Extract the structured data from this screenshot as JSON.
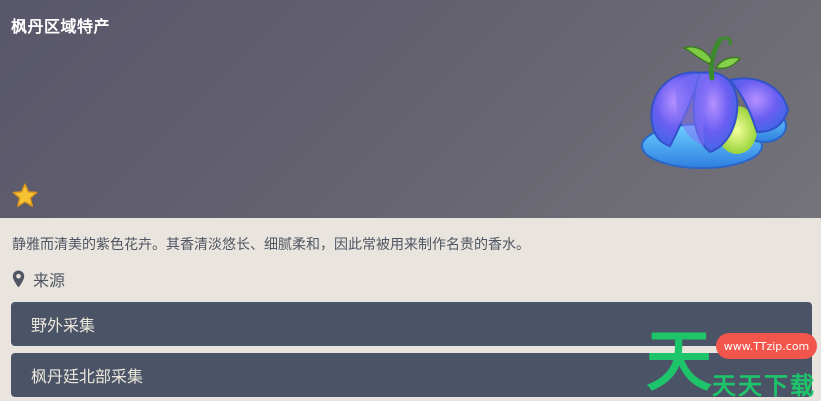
{
  "header": {
    "category": "枫丹区域特产",
    "rarity_stars": 1,
    "star_icon": "star-icon",
    "item_image": "violet-flower-bulb-image"
  },
  "description": "静雅而清美的紫色花卉。其香清淡悠长、细腻柔和，因此常被用来制作名贵的香水。",
  "source": {
    "icon": "location-pin-icon",
    "title": "来源",
    "items": [
      {
        "label": "野外采集"
      },
      {
        "label": "枫丹廷北部采集"
      }
    ]
  },
  "watermark": {
    "logo_glyph": "天",
    "url": "www.TTzip.com",
    "text": "天天下载"
  },
  "colors": {
    "header_bg": "#5f5d6b",
    "body_bg": "#e9e5de",
    "button_bg": "#4b5467",
    "button_text": "#ece7dc",
    "star": "#f5c233",
    "watermark_green": "#1ec46a",
    "watermark_red": "#f2554c"
  }
}
